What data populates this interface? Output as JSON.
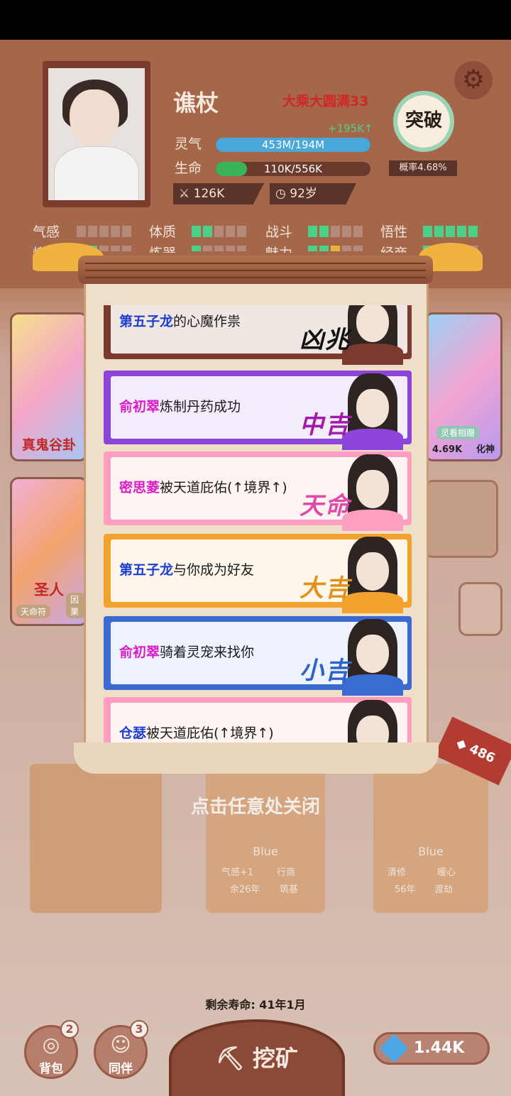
{
  "player": {
    "name": "谯杖",
    "realm": "大乘大圆满33",
    "qi_rate": "+195K↑",
    "qi_label": "灵气",
    "qi_value": "453M/194M",
    "qi_fraction": 1.0,
    "hp_label": "生命",
    "hp_value": "110K/556K",
    "hp_fraction": 0.2,
    "power": "126K",
    "age": "92岁"
  },
  "breakthrough": {
    "label": "突破",
    "probability": "概率4.68%"
  },
  "attributes": [
    {
      "label": "气感",
      "level": 0
    },
    {
      "label": "体质",
      "level": 2
    },
    {
      "label": "战斗",
      "level": 2
    },
    {
      "label": "悟性",
      "level": 5
    }
  ],
  "attributes_row2": [
    "炼丹",
    "炼器",
    "魅力",
    "经商"
  ],
  "side_cards": {
    "left_top": "真鬼谷卦",
    "left_bottom": "圣人",
    "left_bottom_tags": [
      "天命符",
      "因果"
    ],
    "right_top_tag": "灵看相赠",
    "right_top_value": "4.69K",
    "right_top_realm": "化神"
  },
  "events": [
    {
      "name": "第五子龙",
      "text": "的心魔作祟",
      "fortune": "凶兆",
      "name_color": "#1a3fd0",
      "fortune_color": "#111111",
      "border": "#7a3a30",
      "bg": "#f0e7e2"
    },
    {
      "name": "俞初翠",
      "text": "炼制丹药成功",
      "fortune": "中吉",
      "name_color": "#d91ec8",
      "fortune_color": "#a11ba8",
      "border": "#8c45d8",
      "bg": "#f2ecfb"
    },
    {
      "name": "密思菱",
      "text": "被天道庇佑(↑境界↑)",
      "fortune": "天命",
      "name_color": "#d91ec8",
      "fortune_color": "#e04aa8",
      "border": "#ff9ec0",
      "bg": "#fdf4f2"
    },
    {
      "name": "第五子龙",
      "text": "与你成为好友",
      "fortune": "大吉",
      "name_color": "#1a3fd0",
      "fortune_color": "#e3901a",
      "border": "#f3a12f",
      "bg": "#fdf6ea"
    },
    {
      "name": "俞初翠",
      "text": "骑着灵宠来找你",
      "fortune": "小吉",
      "name_color": "#d91ec8",
      "fortune_color": "#2a64c8",
      "border": "#3a6bd1",
      "bg": "#eef2fc"
    },
    {
      "name": "仓瑟",
      "text": "被天道庇佑(↑境界↑)",
      "fortune": "",
      "name_color": "#1a3fd0",
      "fortune_color": "#e04aa8",
      "border": "#ff9ec0",
      "bg": "#fdf4f2"
    }
  ],
  "close_hint": "点击任意处关闭",
  "packs": {
    "middle_label": "Blue",
    "middle_tags": [
      "气感+1",
      "行商"
    ],
    "middle_meta": [
      "余26年",
      "筑基"
    ],
    "right_label": "Blue",
    "right_tags": [
      "清修",
      "暖心"
    ],
    "right_meta": [
      "56年",
      "渡劫"
    ],
    "corner_count": "486"
  },
  "lifespan": "剩余寿命: 41年1月",
  "bottom_nav": {
    "bag_label": "背包",
    "bag_badge": "2",
    "companion_label": "同伴",
    "companion_badge": "3",
    "mine_label": "挖矿",
    "gems": "1.44K"
  },
  "icons": [
    "settings-gear-icon",
    "sword-icon",
    "age-clock-icon",
    "bag-icon",
    "person-icon",
    "pickaxe-icon",
    "gem-icon"
  ]
}
